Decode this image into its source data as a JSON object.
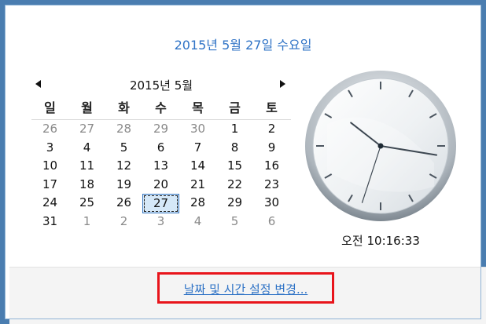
{
  "header": {
    "full_date": "2015년 5월 27일 수요일"
  },
  "calendar": {
    "month_title": "2015년 5월",
    "prev_icon": "triangle-left-icon",
    "next_icon": "triangle-right-icon",
    "weekdays": [
      "일",
      "월",
      "화",
      "수",
      "목",
      "금",
      "토"
    ],
    "weeks": [
      [
        {
          "d": "26",
          "o": true
        },
        {
          "d": "27",
          "o": true
        },
        {
          "d": "28",
          "o": true
        },
        {
          "d": "29",
          "o": true
        },
        {
          "d": "30",
          "o": true
        },
        {
          "d": "1"
        },
        {
          "d": "2"
        }
      ],
      [
        {
          "d": "3"
        },
        {
          "d": "4"
        },
        {
          "d": "5"
        },
        {
          "d": "6"
        },
        {
          "d": "7"
        },
        {
          "d": "8"
        },
        {
          "d": "9"
        }
      ],
      [
        {
          "d": "10"
        },
        {
          "d": "11"
        },
        {
          "d": "12"
        },
        {
          "d": "13"
        },
        {
          "d": "14"
        },
        {
          "d": "15"
        },
        {
          "d": "16"
        }
      ],
      [
        {
          "d": "17"
        },
        {
          "d": "18"
        },
        {
          "d": "19"
        },
        {
          "d": "20"
        },
        {
          "d": "21"
        },
        {
          "d": "22"
        },
        {
          "d": "23"
        }
      ],
      [
        {
          "d": "24"
        },
        {
          "d": "25"
        },
        {
          "d": "26"
        },
        {
          "d": "27",
          "today": true
        },
        {
          "d": "28"
        },
        {
          "d": "29"
        },
        {
          "d": "30"
        }
      ],
      [
        {
          "d": "31"
        },
        {
          "d": "1",
          "o": true
        },
        {
          "d": "2",
          "o": true
        },
        {
          "d": "3",
          "o": true
        },
        {
          "d": "4",
          "o": true
        },
        {
          "d": "5",
          "o": true
        },
        {
          "d": "6",
          "o": true
        }
      ]
    ]
  },
  "clock": {
    "time_text": "오전 10:16:33",
    "hours": 10,
    "minutes": 16,
    "seconds": 33,
    "face_icon": "analog-clock-icon"
  },
  "footer": {
    "link_label": "날짜 및 시간 설정 변경..."
  },
  "colors": {
    "accent": "#2f73c6",
    "highlight_border": "#e8141b",
    "frame": "#4a7db0"
  }
}
